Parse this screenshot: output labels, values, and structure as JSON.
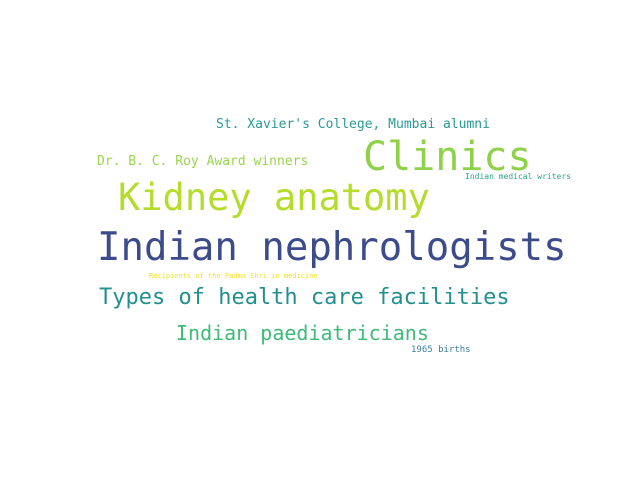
{
  "words": [
    {
      "text": "St. Xavier's College, Mumbai alumni",
      "color": "#2a9a96"
    },
    {
      "text": "Dr. B. C. Roy Award winners",
      "color": "#9ad44e"
    },
    {
      "text": "Clinics",
      "color": "#8fd24a"
    },
    {
      "text": "Indian medical writers",
      "color": "#27a486"
    },
    {
      "text": "Kidney anatomy",
      "color": "#b5dc2b"
    },
    {
      "text": "Indian nephrologists",
      "color": "#3c4b8a"
    },
    {
      "text": "Recipients of the Padma Shri in medicine",
      "color": "#f0e02a"
    },
    {
      "text": "Types of health care facilities",
      "color": "#23908f"
    },
    {
      "text": "Indian paediatricians",
      "color": "#3fba79"
    },
    {
      "text": "1965 births",
      "color": "#3a7f9c"
    }
  ]
}
